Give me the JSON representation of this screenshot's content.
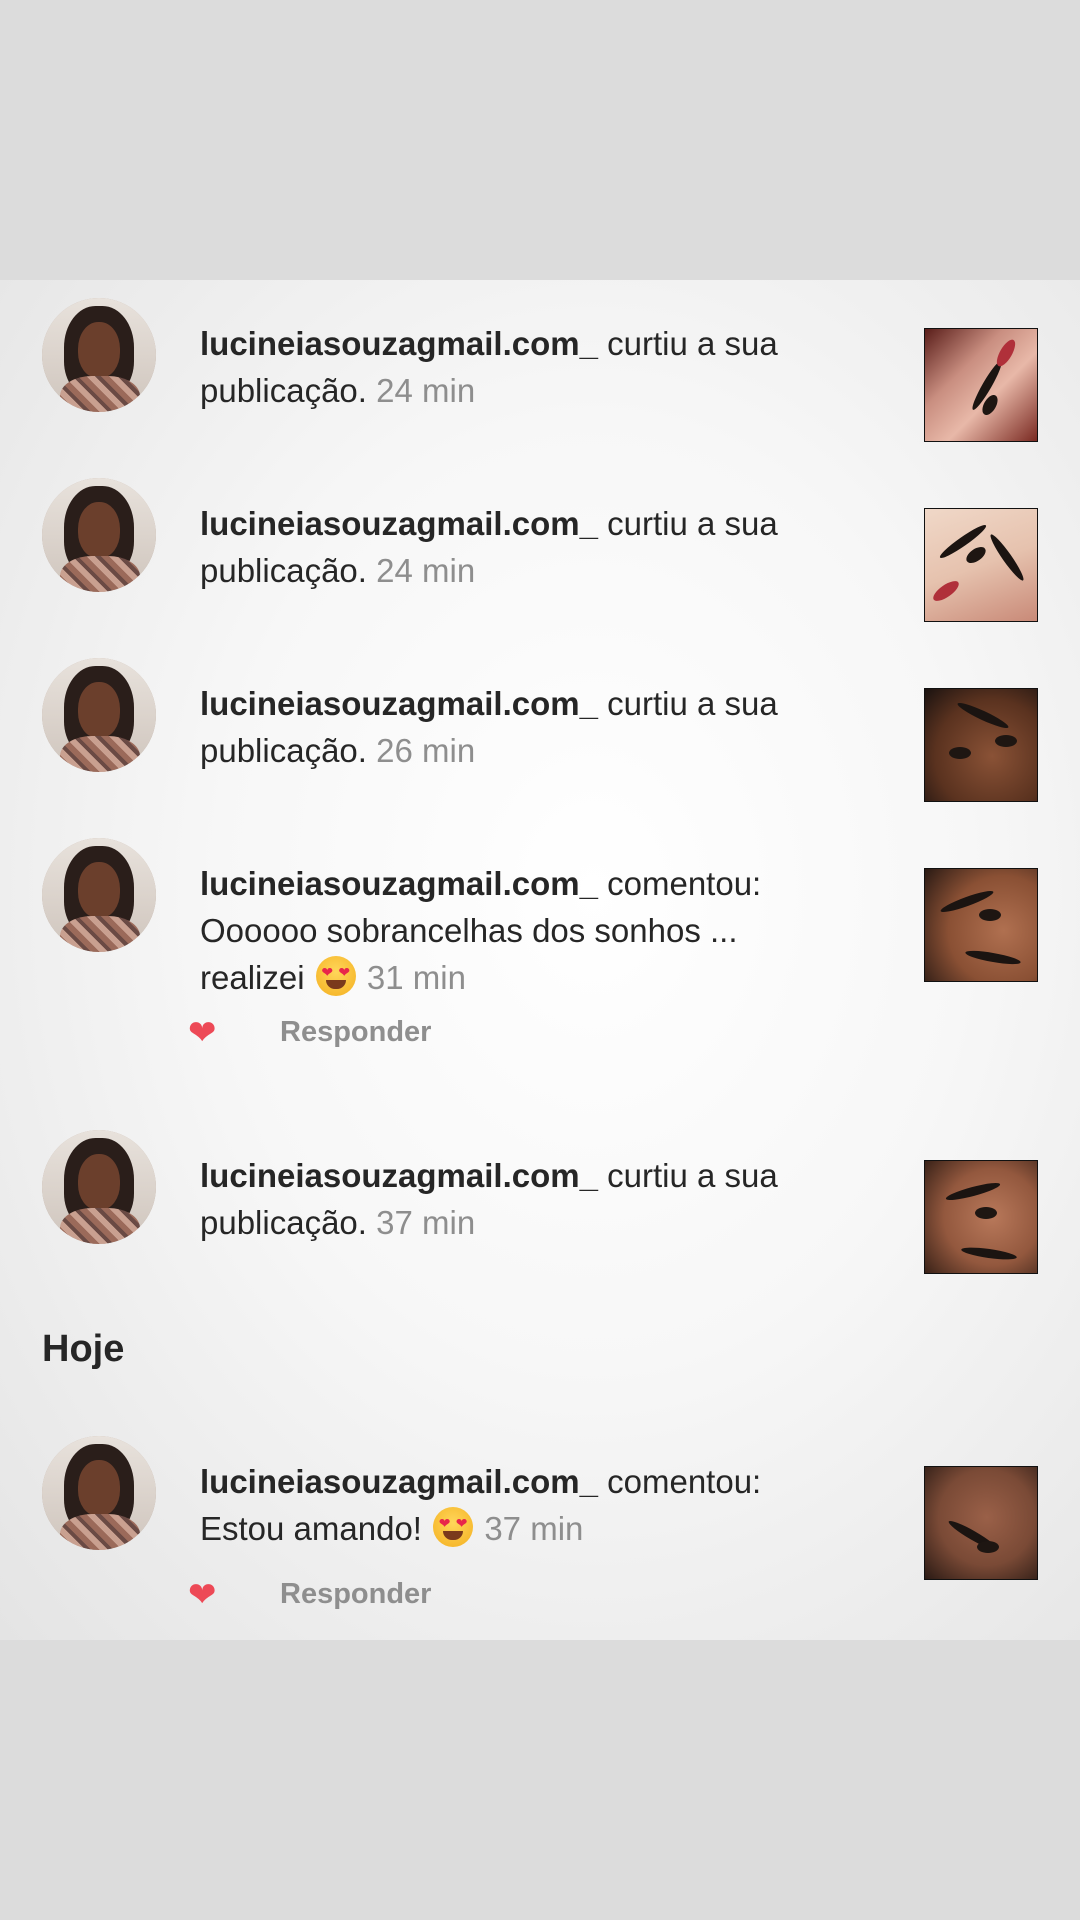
{
  "section_today": "Hoje",
  "notifications": [
    {
      "username": "lucineiasouzagmail.com_",
      "message_a": " curtiu a sua",
      "message_b": "publicação.",
      "time": "24 min",
      "has_reply": false
    },
    {
      "username": "lucineiasouzagmail.com_",
      "message_a": " curtiu a sua",
      "message_b": "publicação.",
      "time": "24 min",
      "has_reply": false
    },
    {
      "username": "lucineiasouzagmail.com_",
      "message_a": " curtiu a sua",
      "message_b": "publicação.",
      "time": "26 min",
      "has_reply": false
    },
    {
      "username": "lucineiasouzagmail.com_",
      "message_a": " comentou:",
      "message_b": "Oooooo sobrancelhas dos sonhos ...",
      "message_c": "realizei",
      "emoji": "smiling-face-with-heart-eyes",
      "time": "31 min",
      "has_reply": true,
      "reply_label": "Responder"
    },
    {
      "username": "lucineiasouzagmail.com_",
      "message_a": " curtiu a sua",
      "message_b": "publicação.",
      "time": "37 min",
      "has_reply": false
    },
    {
      "username": "lucineiasouzagmail.com_",
      "message_a": " comentou:",
      "message_b": "Estou amando!",
      "emoji": "smiling-face-with-heart-eyes",
      "time": "37 min",
      "has_reply": true,
      "reply_label": "Responder"
    }
  ],
  "colors": {
    "text": "#262626",
    "muted": "#8e8e8e",
    "heart": "#ed4956",
    "backdrop": "#dcdcdc"
  }
}
